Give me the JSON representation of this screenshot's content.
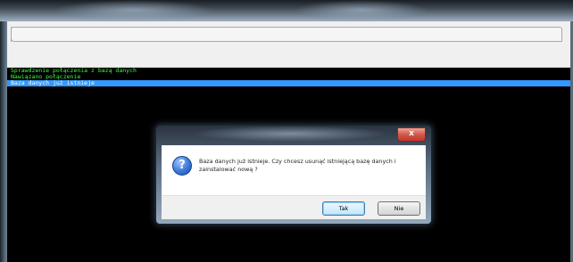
{
  "console": {
    "lines": [
      "Sprawdzenie połączenia z bazą danych",
      "Nawiązano połączenie",
      "Baza danych już istnieje"
    ]
  },
  "dialog": {
    "close_glyph": "x",
    "icon_glyph": "?",
    "message": "Baza danych już istnieje. Czy chcesz usunąć istniejącą bazę danych i zainstalować nową ?",
    "buttons": {
      "yes": "Tak",
      "no": "Nie"
    }
  },
  "colors": {
    "console_ok_text": "#3cff3c",
    "console_selected_bg": "#3399ff",
    "close_button": "#c0392b",
    "question_icon": "#3b78d6"
  }
}
